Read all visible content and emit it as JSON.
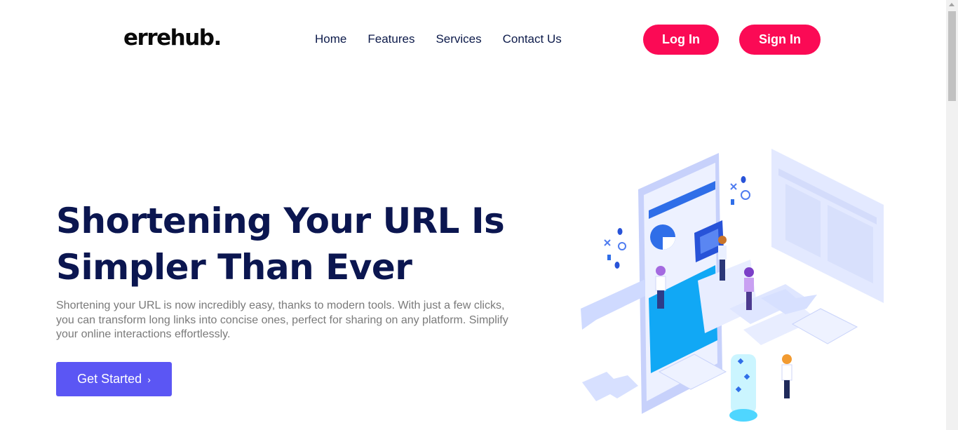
{
  "nav": {
    "logo": "errehub.",
    "links": [
      "Home",
      "Features",
      "Services",
      "Contact Us"
    ],
    "login_label": "Log In",
    "signup_label": "Sign In"
  },
  "hero": {
    "title_line1": "Shortening Your URL Is",
    "title_line2": "Simpler Than Ever",
    "description": "Shortening your URL is now incredibly easy, thanks to modern tools. With just a few clicks, you can transform long links into concise ones, perfect for sharing on any platform. Simplify your online interactions effortlessly.",
    "cta_label": "Get Started",
    "cta_icon": "chevron-right-icon"
  },
  "colors": {
    "accent_pink": "#fb0a55",
    "accent_purple": "#5b56f4",
    "heading": "#0b1650"
  }
}
